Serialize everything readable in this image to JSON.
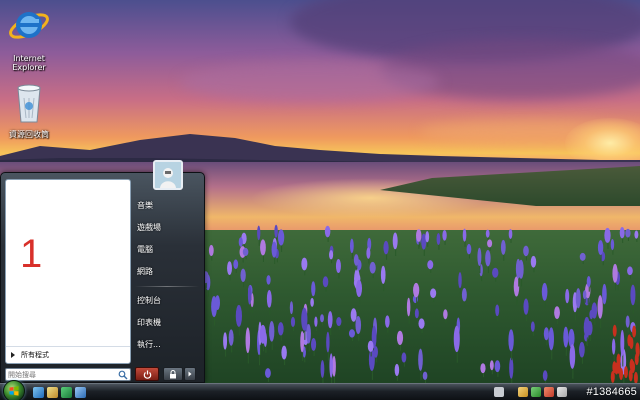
{
  "desktop": {
    "icons": [
      {
        "label": "Internet\nExplorer",
        "icon": "internet-explorer-icon"
      },
      {
        "label": "資源回收筒",
        "icon": "recycle-bin-icon"
      }
    ]
  },
  "start_menu": {
    "pinned_number": "1",
    "all_programs_label": "所有程式",
    "search_placeholder": "開始搜尋",
    "right_items": {
      "music": "音樂",
      "games": "遊戲場",
      "computer": "電腦",
      "network": "網路",
      "control_panel": "控制台",
      "printers": "印表機",
      "run": "執行..."
    },
    "power_icon": "power-icon",
    "lock_icon": "lock-icon"
  },
  "taskbar": {
    "watermark": "#1384665",
    "colors": {
      "orb": "#3a8a2c",
      "bar": "#1c2127",
      "power": "#c24a3a"
    }
  }
}
